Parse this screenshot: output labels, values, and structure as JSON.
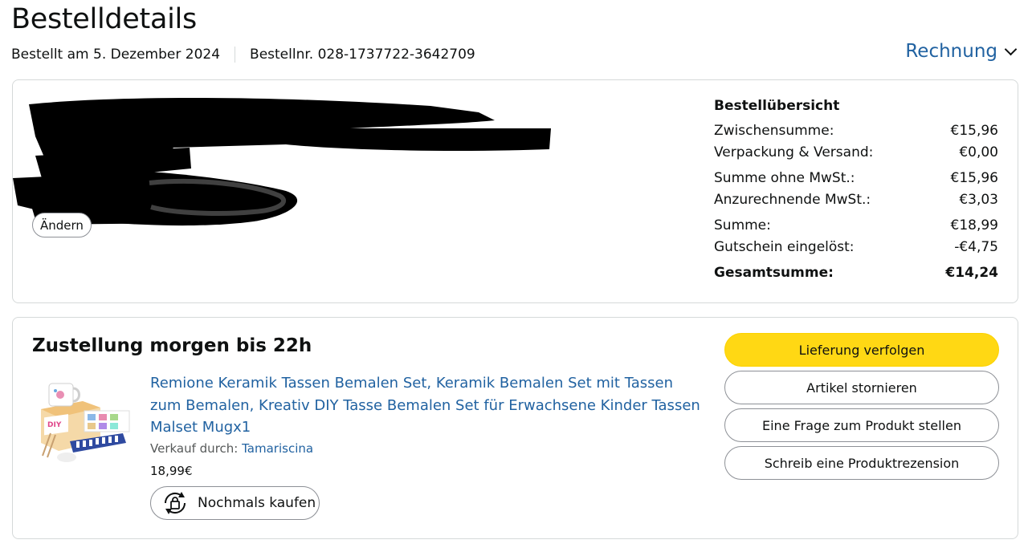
{
  "header": {
    "title": "Bestelldetails",
    "ordered_on": "Bestellt am 5. Dezember 2024",
    "order_number": "Bestellnr. 028-1737722-3642709",
    "invoice_label": "Rechnung"
  },
  "address_block": {
    "change_label": "Ändern"
  },
  "summary": {
    "title": "Bestellübersicht",
    "rows": [
      {
        "label": "Zwischensumme:",
        "value": "€15,96"
      },
      {
        "label": "Verpackung & Versand:",
        "value": "€0,00"
      },
      {
        "label": "Summe ohne MwSt.:",
        "value": "€15,96"
      },
      {
        "label": "Anzurechnende MwSt.:",
        "value": "€3,03"
      },
      {
        "label": "Summe:",
        "value": "€18,99"
      },
      {
        "label": "Gutschein eingelöst:",
        "value": "-€4,75"
      }
    ],
    "total": {
      "label": "Gesamtsumme:",
      "value": "€14,24"
    }
  },
  "delivery": {
    "title": "Zustellung morgen bis 22h",
    "product_title": "Remione Keramik Tassen Bemalen Set, Keramik Bemalen Set mit Tassen zum Bemalen, Kreativ DIY Tasse Bemalen Set für Erwachsene Kinder Tassen Malset Mugx1",
    "sold_by_label": "Verkauf durch:",
    "seller": "Tamariscina",
    "price": "18,99€",
    "buy_again_label": "Nochmals kaufen",
    "product_image_text": "DIY"
  },
  "actions": {
    "track": "Lieferung verfolgen",
    "cancel": "Artikel stornieren",
    "question": "Eine Frage zum Produkt stellen",
    "review": "Schreib eine Produktrezension"
  },
  "colors": {
    "link": "#2162a1",
    "primary_button": "#ffd814",
    "border": "#d5d9d9"
  }
}
